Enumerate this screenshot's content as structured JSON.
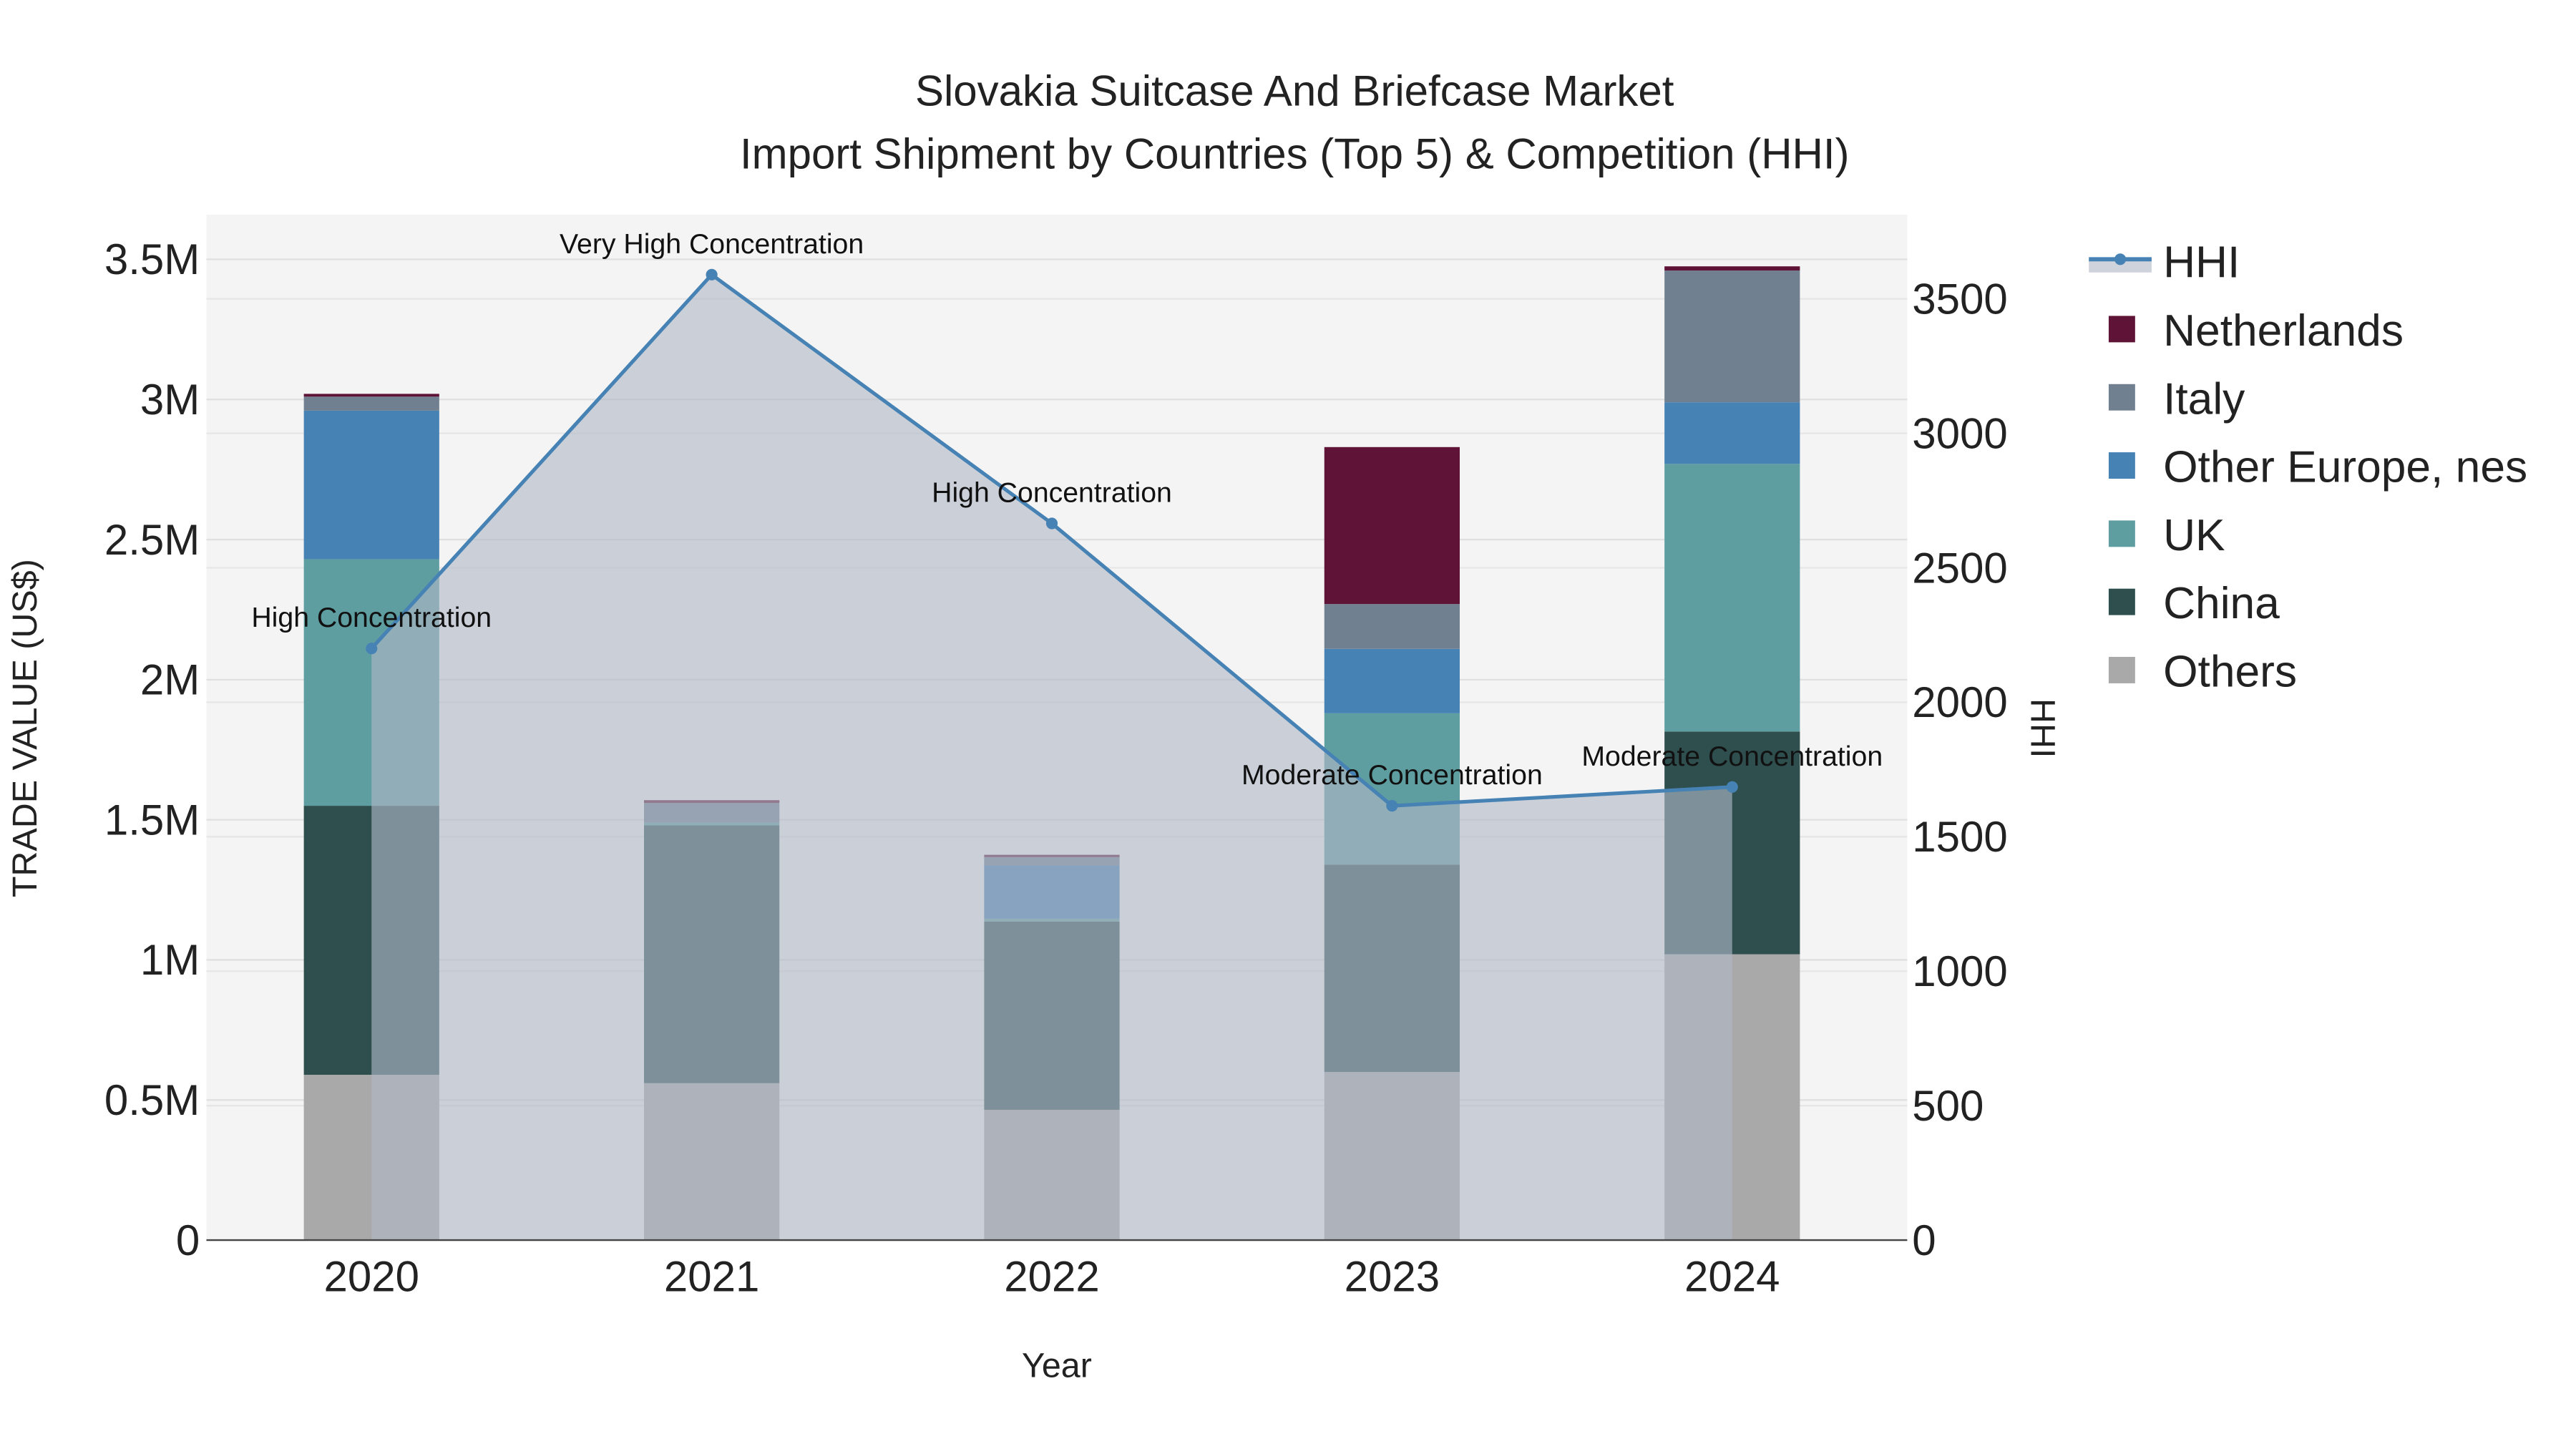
{
  "chart_data": {
    "type": "bar",
    "title_line1": "Slovakia Suitcase And Briefcase Market",
    "title_line2": "Import Shipment by Countries (Top 5) & Competition (HHI)",
    "xlabel": "Year",
    "ylabel": "TRADE VALUE (US$)",
    "y2label": "HHI",
    "categories": [
      "2020",
      "2021",
      "2022",
      "2023",
      "2024"
    ],
    "ylim": [
      0,
      3650000
    ],
    "y2lim": [
      0,
      3800
    ],
    "y_ticks": [
      {
        "v": 0,
        "label": "0"
      },
      {
        "v": 500000,
        "label": "0.5M"
      },
      {
        "v": 1000000,
        "label": "1M"
      },
      {
        "v": 1500000,
        "label": "1.5M"
      },
      {
        "v": 2000000,
        "label": "2M"
      },
      {
        "v": 2500000,
        "label": "2.5M"
      },
      {
        "v": 3000000,
        "label": "3M"
      },
      {
        "v": 3500000,
        "label": "3.5M"
      }
    ],
    "y2_ticks": [
      {
        "v": 0,
        "label": "0"
      },
      {
        "v": 500,
        "label": "500"
      },
      {
        "v": 1000,
        "label": "1000"
      },
      {
        "v": 1500,
        "label": "1500"
      },
      {
        "v": 2000,
        "label": "2000"
      },
      {
        "v": 2500,
        "label": "2500"
      },
      {
        "v": 3000,
        "label": "3000"
      },
      {
        "v": 3500,
        "label": "3500"
      }
    ],
    "series": [
      {
        "name": "Others",
        "color": "#A9A9A9",
        "values": [
          590000,
          560000,
          465000,
          600000,
          1020000
        ]
      },
      {
        "name": "China",
        "color": "#2F4F4F",
        "values": [
          960000,
          920000,
          672000,
          740000,
          795000
        ]
      },
      {
        "name": "UK",
        "color": "#5F9EA0",
        "values": [
          880000,
          10000,
          10000,
          540000,
          955000
        ]
      },
      {
        "name": "Other Europe, nes",
        "color": "#4682B4",
        "values": [
          530000,
          0,
          190000,
          230000,
          220000
        ]
      },
      {
        "name": "Italy",
        "color": "#708090",
        "values": [
          50000,
          70000,
          30000,
          160000,
          470000
        ]
      },
      {
        "name": "Netherlands",
        "color": "#5F1336",
        "values": [
          10000,
          10000,
          8000,
          560000,
          15000
        ]
      }
    ],
    "hhi": {
      "name": "HHI",
      "color": "#4682B4",
      "values": [
        2200,
        3590,
        2665,
        1615,
        1685
      ],
      "annotations": [
        "High Concentration",
        "Very High Concentration",
        "High Concentration",
        "Moderate Concentration",
        "Moderate Concentration"
      ]
    },
    "legend_order": [
      "HHI",
      "Netherlands",
      "Italy",
      "Other Europe, nes",
      "UK",
      "China",
      "Others"
    ],
    "legend_placement": "right",
    "grid": true
  }
}
